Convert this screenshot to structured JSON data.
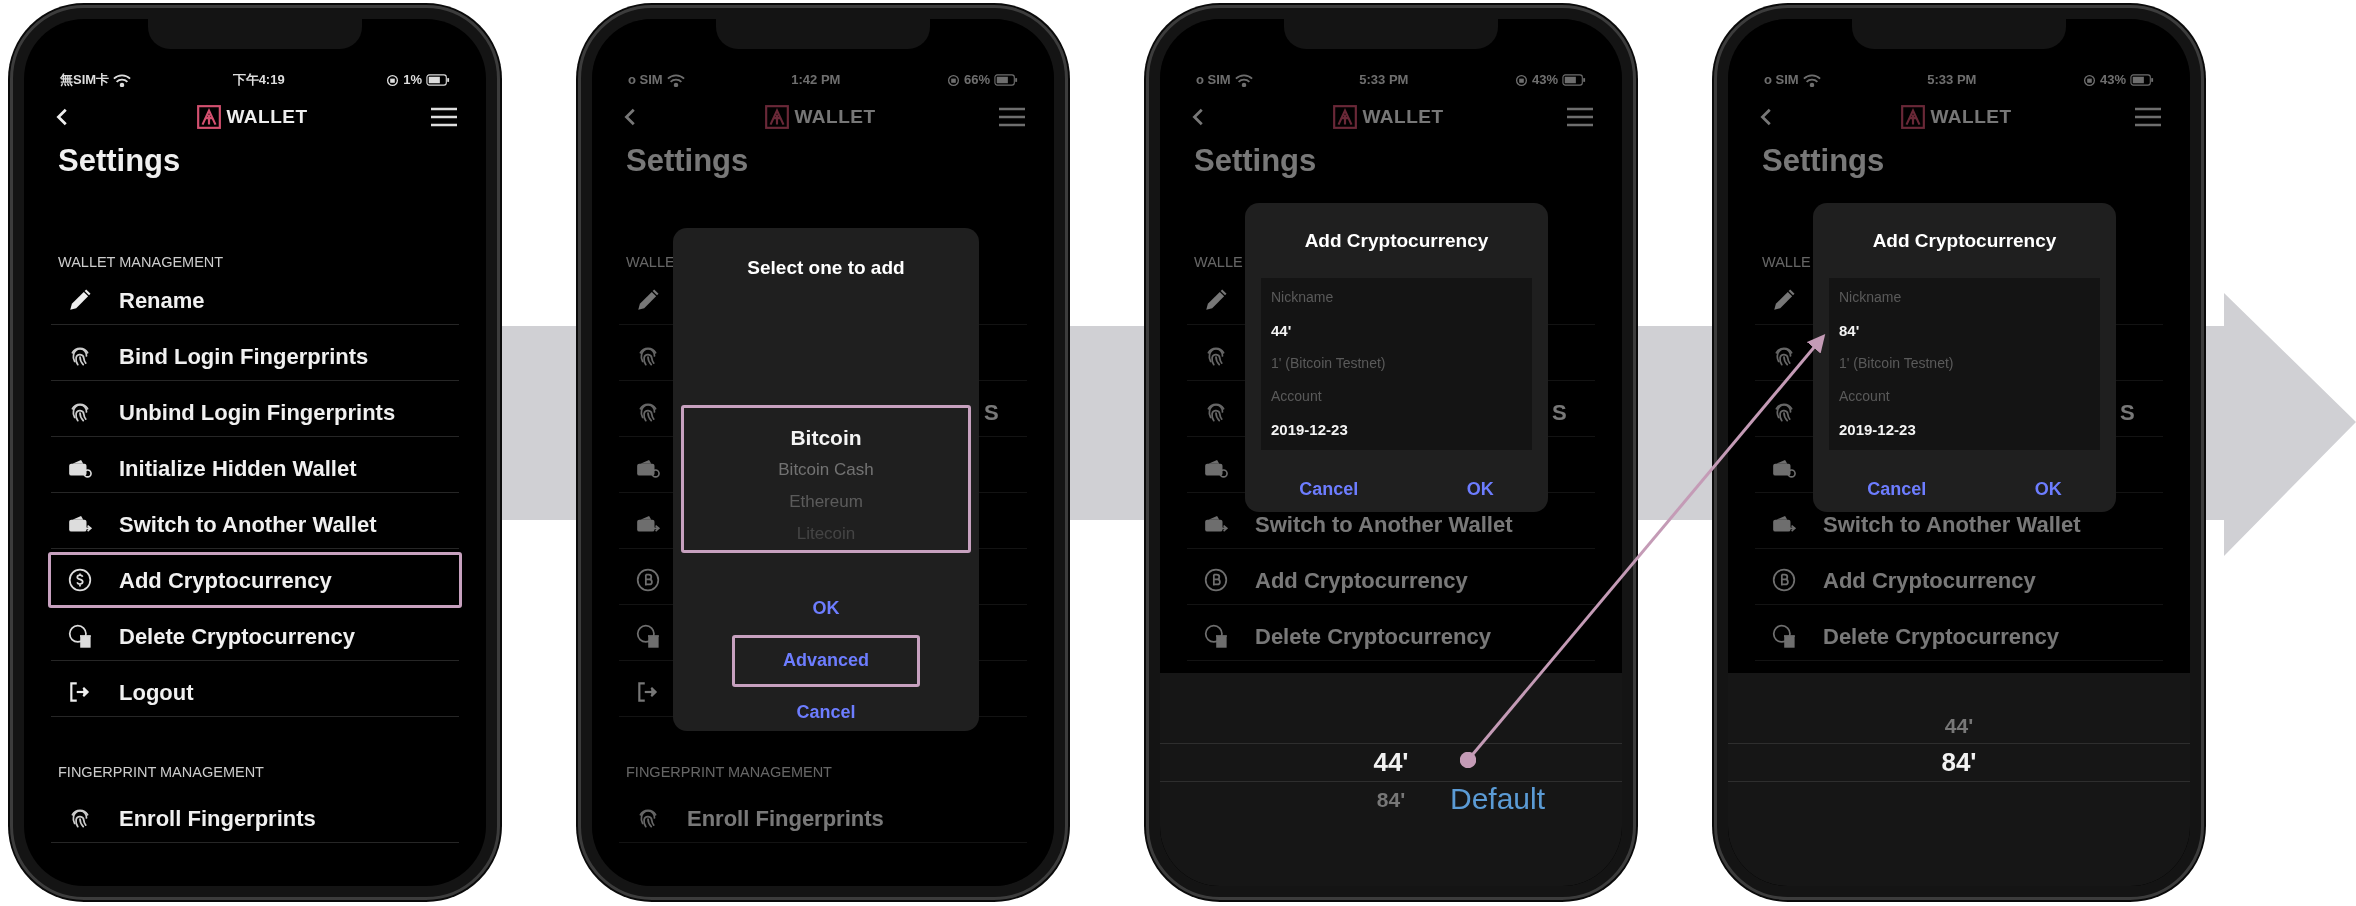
{
  "phones": [
    {
      "status_bar": {
        "carrier": "無SIM卡",
        "time": "下午4:19",
        "battery": "1%"
      },
      "header": {
        "title": "WALLET"
      },
      "page_title": "Settings",
      "dimmed": false,
      "sections": [
        {
          "heading": "WALLET MANAGEMENT",
          "items": [
            {
              "label": "Rename",
              "highlighted": false
            },
            {
              "label": "Bind Login Fingerprints",
              "highlighted": false
            },
            {
              "label": "Unbind Login Fingerprints",
              "highlighted": false
            },
            {
              "label": "Initialize Hidden Wallet",
              "highlighted": false
            },
            {
              "label": "Switch to Another Wallet",
              "highlighted": false
            },
            {
              "label": "Add Cryptocurrency",
              "highlighted": true
            },
            {
              "label": "Delete Cryptocurrency",
              "highlighted": false
            },
            {
              "label": "Logout",
              "highlighted": false
            }
          ]
        },
        {
          "heading": "FINGERPRINT MANAGEMENT",
          "items": [
            {
              "label": "Enroll Fingerprints",
              "highlighted": false
            }
          ]
        }
      ]
    },
    {
      "status_bar": {
        "carrier": "o SIM",
        "time": "1:42 PM",
        "battery": "66%"
      },
      "header": {
        "title": "WALLET"
      },
      "page_title": "Settings",
      "dimmed": true,
      "sections": [
        {
          "heading": "WALLE",
          "items": [
            {
              "highlighted": false
            },
            {
              "highlighted": false
            },
            {
              "fragment": "S",
              "highlighted": false
            },
            {
              "highlighted": false
            },
            {
              "highlighted": false
            },
            {
              "highlighted": false
            },
            {
              "highlighted": false
            },
            {
              "highlighted": false
            }
          ]
        },
        {
          "heading": "FINGERPRINT MANAGEMENT",
          "items": [
            {
              "label": "Enroll Fingerprints",
              "highlighted": false
            }
          ]
        }
      ],
      "dialog": {
        "kind": "picker",
        "title": "Select one to add",
        "highlighted": true,
        "options": [
          {
            "label": "Bitcoin",
            "selected": true
          },
          {
            "label": "Bitcoin Cash",
            "selected": false
          },
          {
            "label": "Ethereum",
            "selected": false
          },
          {
            "label": "Litecoin",
            "selected": false
          }
        ],
        "buttons": [
          {
            "label": "OK",
            "highlighted": false
          },
          {
            "label": "Advanced",
            "highlighted": true
          },
          {
            "label": "Cancel",
            "highlighted": false
          }
        ]
      }
    },
    {
      "status_bar": {
        "carrier": "o SIM",
        "time": "5:33 PM",
        "battery": "43%"
      },
      "header": {
        "title": "WALLET"
      },
      "page_title": "Settings",
      "dimmed": true,
      "sections": [
        {
          "heading": "WALLE",
          "items": [
            {
              "highlighted": false
            },
            {
              "highlighted": false
            },
            {
              "fragment": "S",
              "highlighted": false
            },
            {
              "highlighted": false
            },
            {
              "label": "Switch to Another Wallet",
              "highlighted": false
            },
            {
              "label": "Add Cryptocurrency",
              "highlighted": false
            },
            {
              "label": "Delete Cryptocurrency",
              "highlighted": false
            }
          ]
        }
      ],
      "dialog": {
        "kind": "form",
        "title": "Add Cryptocurrency",
        "fields": [
          {
            "kind": "label",
            "text": "Nickname"
          },
          {
            "kind": "value",
            "text": "44'"
          },
          {
            "kind": "label",
            "text": "1' (Bitcoin Testnet)"
          },
          {
            "kind": "label",
            "text": "Account"
          },
          {
            "kind": "value",
            "text": "2019-12-23"
          }
        ],
        "buttons": [
          {
            "label": "Cancel"
          },
          {
            "label": "OK"
          }
        ]
      },
      "sheet": {
        "options": [
          {
            "label": "44'",
            "selected": true
          },
          {
            "label": "84'",
            "selected": false
          }
        ]
      }
    },
    {
      "status_bar": {
        "carrier": "o SIM",
        "time": "5:33 PM",
        "battery": "43%"
      },
      "header": {
        "title": "WALLET"
      },
      "page_title": "Settings",
      "dimmed": true,
      "sections": [
        {
          "heading": "WALLE",
          "items": [
            {
              "highlighted": false
            },
            {
              "highlighted": false
            },
            {
              "fragment": "S",
              "highlighted": false
            },
            {
              "highlighted": false
            },
            {
              "label": "Switch to Another Wallet",
              "highlighted": false
            },
            {
              "label": "Add Cryptocurrency",
              "highlighted": false
            },
            {
              "label": "Delete Cryptocurrency",
              "highlighted": false
            }
          ]
        }
      ],
      "dialog": {
        "kind": "form",
        "title": "Add Cryptocurrency",
        "fields": [
          {
            "kind": "label",
            "text": "Nickname"
          },
          {
            "kind": "value",
            "text": "84'"
          },
          {
            "kind": "label",
            "text": "1' (Bitcoin Testnet)"
          },
          {
            "kind": "label",
            "text": "Account"
          },
          {
            "kind": "value",
            "text": "2019-12-23"
          }
        ],
        "buttons": [
          {
            "label": "Cancel"
          },
          {
            "label": "OK"
          }
        ]
      },
      "sheet": {
        "options": [
          {
            "label": "44'",
            "selected": false
          },
          {
            "label": "84'",
            "selected": true
          }
        ]
      }
    }
  ],
  "annotations": [
    {
      "kind": "connector"
    },
    {
      "kind": "label",
      "text": "Default"
    }
  ]
}
